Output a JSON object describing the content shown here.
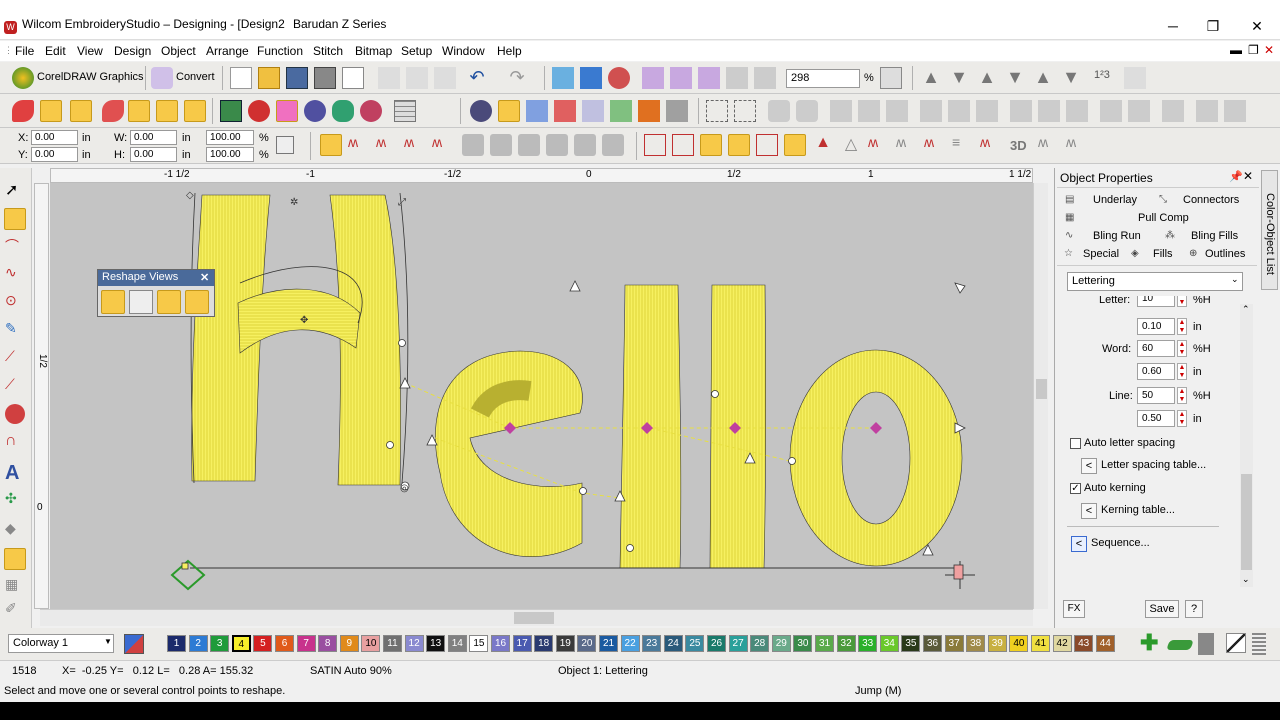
{
  "window": {
    "title": "Wilcom EmbroideryStudio – Designing - [Design2",
    "machine": "Barudan Z Series",
    "minimize": "─",
    "maximize": "❐",
    "close": "✕"
  },
  "menu": [
    "File",
    "Edit",
    "View",
    "Design",
    "Object",
    "Arrange",
    "Function",
    "Stitch",
    "Bitmap",
    "Setup",
    "Window",
    "Help"
  ],
  "toolbar": {
    "coreldraw_label": "CorelDRAW Graphics",
    "convert_label": "Convert",
    "zoom_value": "298",
    "zoom_unit": "%",
    "label_3d": "3D"
  },
  "coords": {
    "x_label": "X:",
    "x_value": "0.00",
    "y_label": "Y:",
    "y_value": "0.00",
    "w_label": "W:",
    "w_value": "0.00",
    "h_label": "H:",
    "h_value": "0.00",
    "unit": "in",
    "w_pct": "100.00",
    "h_pct": "100.00",
    "pct": "%"
  },
  "ruler": {
    "labels": [
      "-1 1/2",
      "-1",
      "-1/2",
      "0",
      "1/2",
      "1",
      "1 1/2"
    ],
    "v_labels": [
      "1/2",
      "0"
    ]
  },
  "reshape_views": {
    "title": "Reshape Views",
    "close": "✕"
  },
  "props": {
    "title": "Object Properties",
    "tabs": {
      "underlay": "Underlay",
      "connectors": "Connectors",
      "pull_comp": "Pull Comp",
      "bling_run": "Bling Run",
      "bling_fills": "Bling Fills",
      "special": "Special",
      "fills": "Fills",
      "outlines": "Outlines"
    },
    "dropdown": "Lettering",
    "letter_label": "Letter:",
    "letter_pct": "10",
    "letter_in": "0.10",
    "word_label": "Word:",
    "word_pct": "60",
    "word_in": "0.60",
    "line_label": "Line:",
    "line_pct": "50",
    "line_in": "0.50",
    "unit_pct": "%H",
    "unit_in": "in",
    "auto_letter_spacing": "Auto letter spacing",
    "letter_spacing_table": "Letter spacing table...",
    "auto_kerning": "Auto kerning",
    "kerning_table": "Kerning table...",
    "sequence": "Sequence...",
    "fx": "FX",
    "save": "Save",
    "help": "?",
    "side_tab": "Color-Object List"
  },
  "colorway": "Colorway 1",
  "palette": [
    {
      "n": "1",
      "c": "#1b2a6b"
    },
    {
      "n": "2",
      "c": "#2d7bd4"
    },
    {
      "n": "3",
      "c": "#1f9b3a"
    },
    {
      "n": "4",
      "c": "#f6ee2a"
    },
    {
      "n": "5",
      "c": "#d42020"
    },
    {
      "n": "6",
      "c": "#e05a1a"
    },
    {
      "n": "7",
      "c": "#c8328c"
    },
    {
      "n": "8",
      "c": "#9a4fa0"
    },
    {
      "n": "9",
      "c": "#e08a1a"
    },
    {
      "n": "10",
      "c": "#e8a0a0"
    },
    {
      "n": "11",
      "c": "#707070"
    },
    {
      "n": "12",
      "c": "#8a8ad0"
    },
    {
      "n": "13",
      "c": "#101010"
    },
    {
      "n": "14",
      "c": "#808080"
    },
    {
      "n": "15",
      "c": "#ffffff"
    },
    {
      "n": "16",
      "c": "#7a78c8"
    },
    {
      "n": "17",
      "c": "#4a5ab0"
    },
    {
      "n": "18",
      "c": "#2a3a70"
    },
    {
      "n": "19",
      "c": "#3a3a3a"
    },
    {
      "n": "20",
      "c": "#5a6a8a"
    },
    {
      "n": "21",
      "c": "#1a5aa0"
    },
    {
      "n": "22",
      "c": "#4aa0e0"
    },
    {
      "n": "23",
      "c": "#4a7a9a"
    },
    {
      "n": "24",
      "c": "#2a5a7a"
    },
    {
      "n": "25",
      "c": "#3a8aa0"
    },
    {
      "n": "26",
      "c": "#1a7a6a"
    },
    {
      "n": "27",
      "c": "#2aa09a"
    },
    {
      "n": "28",
      "c": "#4a8a7a"
    },
    {
      "n": "29",
      "c": "#6aaa8a"
    },
    {
      "n": "30",
      "c": "#3a8a4a"
    },
    {
      "n": "31",
      "c": "#5aaa4a"
    },
    {
      "n": "32",
      "c": "#4a9a3a"
    },
    {
      "n": "33",
      "c": "#2ab02a"
    },
    {
      "n": "34",
      "c": "#6ac82a"
    },
    {
      "n": "35",
      "c": "#2a3a1a"
    },
    {
      "n": "36",
      "c": "#5a5a3a"
    },
    {
      "n": "37",
      "c": "#8a7a3a"
    },
    {
      "n": "38",
      "c": "#a08a4a"
    },
    {
      "n": "39",
      "c": "#c8b040"
    },
    {
      "n": "40",
      "c": "#f0d020"
    },
    {
      "n": "41",
      "c": "#f0e040"
    },
    {
      "n": "42",
      "c": "#e0d8a0"
    },
    {
      "n": "43",
      "c": "#8a4a2a"
    },
    {
      "n": "44",
      "c": "#a0602a"
    }
  ],
  "status": {
    "count": "1518",
    "coords": "X=  -0.25 Y=   0.12 L=   0.28 A= 155.32",
    "stitch": "SATIN Auto 90%",
    "object": "Object 1: Lettering",
    "hint": "Select and move one or several control points to reshape.",
    "jump": "Jump (M)"
  },
  "icons": [
    "select-icon",
    "reshape-icon",
    "text-icon",
    "zoom-icon"
  ]
}
